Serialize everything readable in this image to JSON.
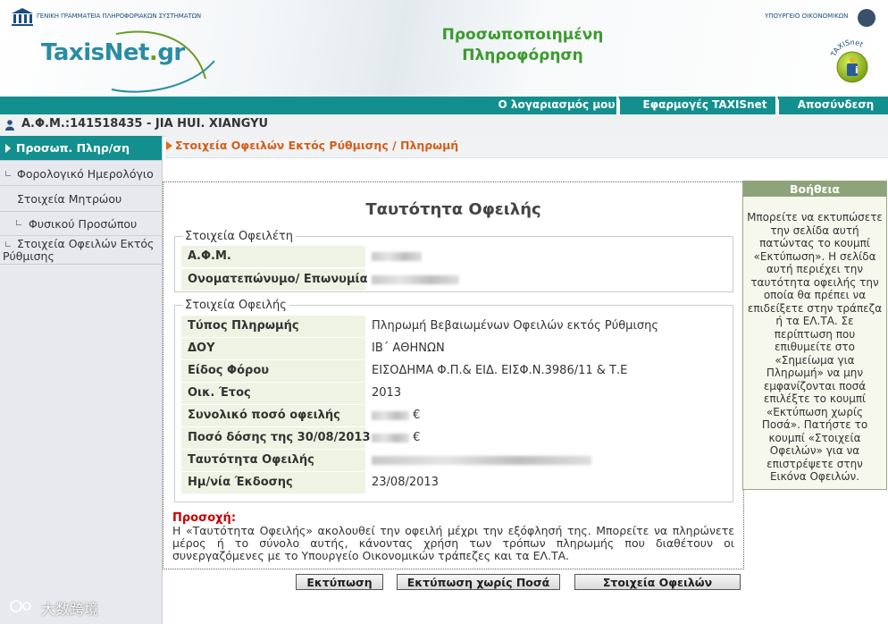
{
  "header": {
    "gsis_text": "ΓΕΝΙΚΗ ΓΡΑΜΜΑΤΕΙΑ ΠΛΗΡΟΦΟΡΙΑΚΩΝ ΣΥΣΤΗΜΑΤΩΝ",
    "logo_main": "TaxisNet",
    "logo_dot": ".",
    "logo_suffix": "gr",
    "title_line1": "Προσωποποιημένη",
    "title_line2": "Πληροφόρηση",
    "ministry": "ΥΠΟΥΡΓΕΙΟ ΟΙΚΟΝΟΜΙΚΩΝ",
    "badge_text": "TAXISnet",
    "badge_icon": "i"
  },
  "nav": {
    "account": "Ο λογαριασμός μου",
    "apps": "Εφαρμογές TAXISnet",
    "logout": "Αποσύνδεση"
  },
  "user": {
    "label": "Α.Φ.Μ.:141518435 - JIA HUI. XIANGYU"
  },
  "sidebar": {
    "items": [
      {
        "label": "Προσωπ. Πληρ/ση"
      },
      {
        "label": "Φορολογικό Ημερολόγιο"
      },
      {
        "label": "Στοιχεία Μητρώου"
      },
      {
        "label": "Φυσικού Προσώπου"
      },
      {
        "label": "Στοιχεία Οφειλών Εκτός Ρύθμισης"
      }
    ]
  },
  "breadcrumb": "Στοιχεία Οφειλών Εκτός Ρύθμισης / Πληρωμή",
  "main": {
    "title": "Ταυτότητα Οφειλής",
    "debtor_legend": "Στοιχεία Οφειλέτη",
    "debtor_rows": [
      {
        "label": "Α.Φ.Μ."
      },
      {
        "label": "Ονοματεπώνυμο/ Επωνυμία"
      }
    ],
    "debt_legend": "Στοιχεία Οφειλής",
    "debt_rows": [
      {
        "label": "Τύπος Πληρωμής",
        "value": "Πληρωμή Βεβαιωμένων Οφειλών εκτός Ρύθμισης"
      },
      {
        "label": "ΔΟΥ",
        "value": "ΙΒ΄ ΑΘΗΝΩΝ"
      },
      {
        "label": "Είδος Φόρου",
        "value": "ΕΙΣΟΔΗΜΑ Φ.Π.& ΕΙΔ. ΕΙΣΦ.Ν.3986/11 & Τ.Ε"
      },
      {
        "label": "Οικ. Έτος",
        "value": "2013"
      },
      {
        "label": "Συνολικό ποσό οφειλής",
        "value": "€"
      },
      {
        "label": "Ποσό δόσης της 30/08/2013",
        "value": "€"
      },
      {
        "label": "Ταυτότητα Οφειλής",
        "value": ""
      },
      {
        "label": "Ημ/νία Έκδοσης",
        "value": "23/08/2013"
      }
    ],
    "warning_title": "Προσοχή:",
    "warning_text": "Η «Ταυτότητα Οφειλής» ακολουθεί την οφειλή μέχρι την εξόφλησή της. Μπορείτε να πληρώνετε μέρος ή το σύνολο αυτής, κάνοντας χρήση των τρόπων πληρωμής που διαθέτουν οι συνεργαζόμενες με το Υπουργείο Οικονομικών τράπεζες και τα ΕΛ.ΤΑ."
  },
  "buttons": {
    "print": "Εκτύπωση",
    "print_no_amount": "Εκτύπωση χωρίς Ποσά",
    "debts": "Στοιχεία Οφειλών"
  },
  "help": {
    "title": "Βοήθεια",
    "text": "Μπορείτε να εκτυπώσετε την σελίδα αυτή πατώντας το κουμπί «Εκτύπωση». Η σελίδα αυτή περιέχει την ταυτότητα οφειλής την οποία θα πρέπει να επιδείξετε στην τράπεζα ή τα ΕΛ.ΤΑ. Σε περίπτωση που επιθυμείτε στο «Σημείωμα για Πληρωμή» να μην εμφανίζονται ποσά επιλέξτε το κουμπί «Εκτύπωση χωρίς Ποσά». Πατήστε το κουμπί «Στοιχεία Οφειλών» για να επιστρέψετε στην Εικόνα Οφειλών."
  },
  "watermark": "大数跨境",
  "icons": {
    "user": "user-icon",
    "gsis": "gsis-building-icon",
    "emblem": "ministry-emblem-icon",
    "info": "info-badge-icon"
  },
  "colors": {
    "teal": "#138f8f",
    "green_title": "#3b9b2e",
    "breadcrumb_orange": "#d2601a",
    "warning_red": "#cc0000",
    "help_header": "#8ea37a"
  }
}
